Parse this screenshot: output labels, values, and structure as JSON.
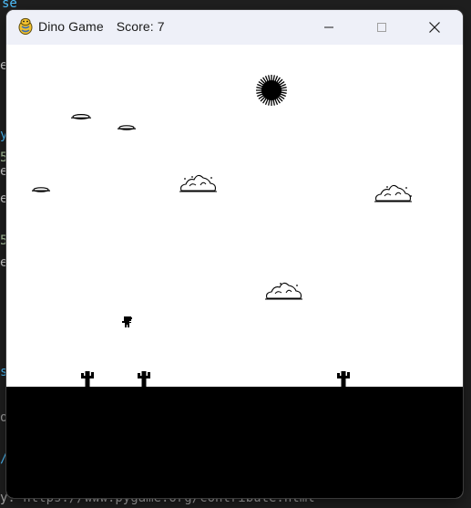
{
  "window": {
    "app_name": "Dino Game",
    "score_text": "Score: 7",
    "controls": {
      "minimize": "minimize",
      "maximize": "maximize",
      "close": "close"
    }
  },
  "background_editor": {
    "fragments": [
      "se",
      "e",
      "e",
      "5",
      "e",
      "5",
      "e",
      "y",
      "/",
      "s",
      "5",
      "o",
      "y: https://www.pygame.org/contribute.html"
    ]
  },
  "game": {
    "score": 7,
    "colors": {
      "sky": "#ffffff",
      "ground": "#000000",
      "sprite": "#000000"
    },
    "sprites": {
      "sun": "sun-icon",
      "player": "dino-icon",
      "clouds": [
        "cloud-icon",
        "cloud-icon",
        "cloud-icon"
      ],
      "rocks": [
        "rock-cloud-icon",
        "rock-cloud-icon",
        "rock-cloud-icon"
      ],
      "cacti": [
        "cactus-icon",
        "cactus-icon",
        "cactus-icon"
      ]
    }
  }
}
